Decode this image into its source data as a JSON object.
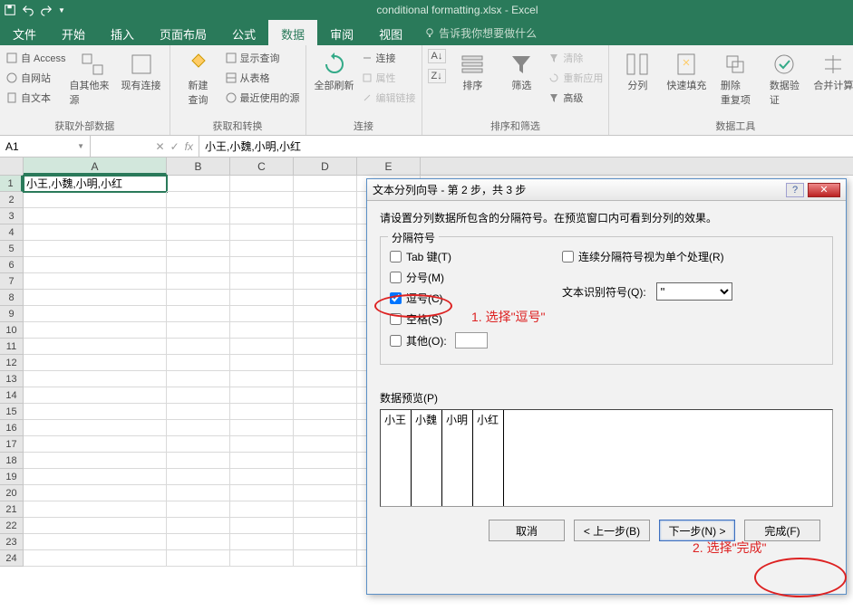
{
  "title_bar": {
    "app_title": "conditional formatting.xlsx - Excel"
  },
  "menu": {
    "file": "文件",
    "home": "开始",
    "insert": "插入",
    "page_layout": "页面布局",
    "formulas": "公式",
    "data": "数据",
    "review": "审阅",
    "view": "视图",
    "tell_me": "告诉我你想要做什么"
  },
  "ribbon": {
    "ext_data": {
      "access": "自 Access",
      "web": "自网站",
      "text": "自文本",
      "other": "自其他来源",
      "existing": "现有连接",
      "label": "获取外部数据"
    },
    "transform": {
      "new_query": "新建\n查询",
      "show_query": "显示查询",
      "from_table": "从表格",
      "recent": "最近使用的源",
      "label": "获取和转换"
    },
    "connections": {
      "refresh_all": "全部刷新",
      "connections": "连接",
      "properties": "属性",
      "edit_links": "编辑链接",
      "label": "连接"
    },
    "sort_filter": {
      "sort": "排序",
      "filter": "筛选",
      "clear": "清除",
      "reapply": "重新应用",
      "advanced": "高级",
      "label": "排序和筛选"
    },
    "data_tools": {
      "text_to_cols": "分列",
      "flash_fill": "快速填充",
      "remove_dup": "删除\n重复项",
      "validation": "数据验\n证",
      "consolidate": "合并计算",
      "label": "数据工具"
    }
  },
  "name_box": "A1",
  "formula": "小王,小魏,小明,小红",
  "columns": [
    "A",
    "B",
    "C",
    "D",
    "E"
  ],
  "rows": [
    "1",
    "2",
    "3",
    "4",
    "5",
    "6",
    "7",
    "8",
    "9",
    "10",
    "11",
    "12",
    "13",
    "14",
    "15",
    "16",
    "17",
    "18",
    "19",
    "20",
    "21",
    "22",
    "23",
    "24"
  ],
  "cell_a1": "小王,小魏,小明,小红",
  "dialog": {
    "title": "文本分列向导 - 第 2 步，共 3 步",
    "desc": "请设置分列数据所包含的分隔符号。在预览窗口内可看到分列的效果。",
    "delim_legend": "分隔符号",
    "tab": "Tab 键(T)",
    "semicolon": "分号(M)",
    "comma": "逗号(C)",
    "space": "空格(S)",
    "other": "其他(O):",
    "treat_consecutive": "连续分隔符号视为单个处理(R)",
    "qualifier_label": "文本识别符号(Q):",
    "qualifier_value": "\"",
    "preview_label": "数据预览(P)",
    "preview_cols": [
      "小王",
      "小魏",
      "小明",
      "小红"
    ],
    "cancel": "取消",
    "back": "< 上一步(B)",
    "next": "下一步(N) >",
    "finish": "完成(F)"
  },
  "annotations": {
    "a1": "1. 选择\"逗号\"",
    "a2": "2. 选择\"完成\""
  }
}
